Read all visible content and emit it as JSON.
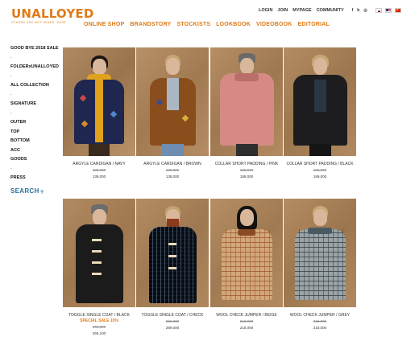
{
  "brand": {
    "name": "UNALLOYED",
    "tagline": "OTHERS ARE NOT MIXED, PURE",
    "accent_color": "#e07a16"
  },
  "top_nav": [
    "ONLINE SHOP",
    "BRANDSTORY",
    "STOCKISTS",
    "LOOKBOOK",
    "VIDEOBOOK",
    "EDITORIAL"
  ],
  "utility_links": [
    "LOGIN",
    "JOIN",
    "MYPAGE",
    "COMMUNITY"
  ],
  "social_icons": [
    "facebook-icon",
    "blog-icon",
    "instagram-icon"
  ],
  "language_flags": [
    "korea-flag",
    "usa-flag",
    "china-flag"
  ],
  "sidebar": {
    "items": [
      {
        "label": "GOOD BYE 2018 SALE"
      },
      {
        "label": "-"
      },
      {
        "label": "FOLDERxUNALLOYED"
      },
      {
        "label": "-"
      },
      {
        "label": "ALL COLLECTION"
      },
      {
        "label": "-"
      },
      {
        "label": "SIGNATURE"
      },
      {
        "label": "-"
      },
      {
        "label": "OUTER"
      },
      {
        "label": "TOP"
      },
      {
        "label": "BOTTOM"
      },
      {
        "label": "ACC"
      },
      {
        "label": "GOODS"
      },
      {
        "label": "-"
      },
      {
        "label": "PRESS"
      }
    ],
    "search_label": "SEARCH",
    "search_icon": "magnifier-icon"
  },
  "products": [
    {
      "name": "ARGYLE CARDIGAN / NAVY",
      "original_price": "135,000",
      "price": "138,000",
      "sale_tag": ""
    },
    {
      "name": "ARGYLE CARDIGAN / BROWN",
      "original_price": "135,000",
      "price": "138,000",
      "sale_tag": ""
    },
    {
      "name": "COLLAR SHORT PADDING / PINK",
      "original_price": "185,000",
      "price": "189,000",
      "sale_tag": ""
    },
    {
      "name": "COLLAR SHORT PADDING / BLACK",
      "original_price": "185,000",
      "price": "189,000",
      "sale_tag": ""
    },
    {
      "name": "TOGGLE SINGLE COAT / BLACK",
      "original_price": "265,000",
      "price": "265,100",
      "sale_tag": "SPECIAL SALE 10%"
    },
    {
      "name": "TOGGLE SINGLE COAT / CHECK",
      "original_price": "285,000",
      "price": "289,000",
      "sale_tag": ""
    },
    {
      "name": "WOOL CHECK JUMPER / BEIGE",
      "original_price": "218,000",
      "price": "218,000",
      "sale_tag": ""
    },
    {
      "name": "WOOL CHECK JUMPER / GREY",
      "original_price": "218,000",
      "price": "218,000",
      "sale_tag": ""
    }
  ],
  "colors": {
    "photo_backdrop": "#a8805a",
    "search_text": "#2a6f9e"
  }
}
